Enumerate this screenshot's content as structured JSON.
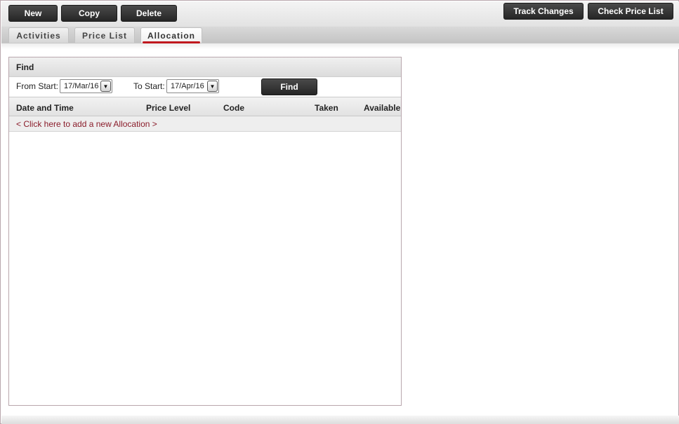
{
  "toolbar": {
    "new_label": "New",
    "copy_label": "Copy",
    "delete_label": "Delete",
    "track_changes_label": "Track Changes",
    "check_price_list_label": "Check Price List"
  },
  "tabs": [
    {
      "label": "Activities",
      "active": false
    },
    {
      "label": "Price List",
      "active": false
    },
    {
      "label": "Allocation",
      "active": true
    }
  ],
  "find": {
    "header": "Find",
    "from_start_label": "From Start:",
    "from_start_value": "17/Mar/16",
    "to_start_label": "To Start:",
    "to_start_value": "17/Apr/16",
    "find_button_label": "Find",
    "dropdown_icon": "▼"
  },
  "table": {
    "columns": [
      "Date and Time",
      "Price Level",
      "Code",
      "Taken",
      "Available"
    ],
    "add_row_text": "< Click here to add a new Allocation >",
    "rows": []
  },
  "colors": {
    "accent": "#c0181e",
    "link": "#8a1c2a",
    "button": "#2b2b2b",
    "border": "#b9a7ad"
  }
}
